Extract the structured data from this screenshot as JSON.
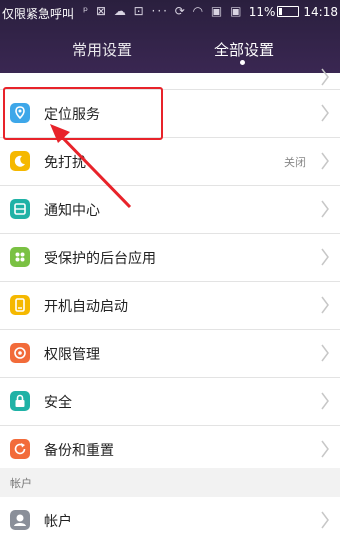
{
  "status_bar": {
    "left_text": "仅限紧急呼叫",
    "icons": [
      "sim-icon",
      "gallery-icon",
      "cloud-icon",
      "mail-icon",
      "more-icon",
      "sync-icon",
      "wifi-icon",
      "sim-card-icon",
      "sim-card-icon"
    ],
    "battery_text": "11%",
    "time": "14:18"
  },
  "tabs": [
    {
      "label": "常用设置",
      "active": false
    },
    {
      "label": "全部设置",
      "active": true
    }
  ],
  "items": [
    {
      "label": "定位服务",
      "icon": "location-icon",
      "color": "#3ea7e9",
      "value": ""
    },
    {
      "label": "免打扰",
      "icon": "moon-icon",
      "color": "#f5b800",
      "value": "关闭"
    },
    {
      "label": "通知中心",
      "icon": "notification-icon",
      "color": "#1fb2a6",
      "value": ""
    },
    {
      "label": "受保护的后台应用",
      "icon": "protected-apps-icon",
      "color": "#7ac143",
      "value": ""
    },
    {
      "label": "开机自动启动",
      "icon": "autostart-icon",
      "color": "#f5b800",
      "value": ""
    },
    {
      "label": "权限管理",
      "icon": "permission-icon",
      "color": "#f26b3a",
      "value": ""
    },
    {
      "label": "安全",
      "icon": "security-icon",
      "color": "#1fb2a6",
      "value": ""
    },
    {
      "label": "备份和重置",
      "icon": "backup-icon",
      "color": "#f26b3a",
      "value": ""
    }
  ],
  "section": {
    "label": "帐户"
  },
  "account_item": {
    "label": "帐户",
    "icon": "account-icon",
    "color": "#8a8f99"
  },
  "colors": {
    "header": "#2a1f3e",
    "highlight": "#e8232a"
  }
}
